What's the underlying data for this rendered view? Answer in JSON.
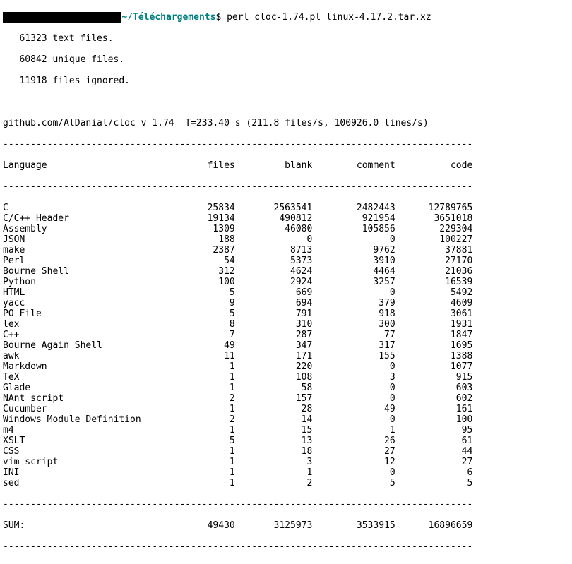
{
  "prompt": {
    "redacted": "xxxxxxxxxxxxxxxxxxxxx",
    "path": "~/Téléchargements",
    "dollar": "$",
    "command": "perl cloc-1.74.pl linux-4.17.2.tar.xz"
  },
  "preamble": {
    "line1": "   61323 text files.",
    "line2": "   60842 unique files.",
    "line3": "   11918 files ignored."
  },
  "meta_line": "github.com/AlDanial/cloc v 1.74  T=233.40 s (211.8 files/s, 100926.0 lines/s)",
  "header": {
    "language": "Language",
    "files": "files",
    "blank": "blank",
    "comment": "comment",
    "code": "code"
  },
  "rows": [
    {
      "language": "C",
      "files": "25834",
      "blank": "2563541",
      "comment": "2482443",
      "code": "12789765"
    },
    {
      "language": "C/C++ Header",
      "files": "19134",
      "blank": "490812",
      "comment": "921954",
      "code": "3651018"
    },
    {
      "language": "Assembly",
      "files": "1309",
      "blank": "46080",
      "comment": "105856",
      "code": "229304"
    },
    {
      "language": "JSON",
      "files": "188",
      "blank": "0",
      "comment": "0",
      "code": "100227"
    },
    {
      "language": "make",
      "files": "2387",
      "blank": "8713",
      "comment": "9762",
      "code": "37881"
    },
    {
      "language": "Perl",
      "files": "54",
      "blank": "5373",
      "comment": "3910",
      "code": "27170"
    },
    {
      "language": "Bourne Shell",
      "files": "312",
      "blank": "4624",
      "comment": "4464",
      "code": "21036"
    },
    {
      "language": "Python",
      "files": "100",
      "blank": "2924",
      "comment": "3257",
      "code": "16539"
    },
    {
      "language": "HTML",
      "files": "5",
      "blank": "669",
      "comment": "0",
      "code": "5492"
    },
    {
      "language": "yacc",
      "files": "9",
      "blank": "694",
      "comment": "379",
      "code": "4609"
    },
    {
      "language": "PO File",
      "files": "5",
      "blank": "791",
      "comment": "918",
      "code": "3061"
    },
    {
      "language": "lex",
      "files": "8",
      "blank": "310",
      "comment": "300",
      "code": "1931"
    },
    {
      "language": "C++",
      "files": "7",
      "blank": "287",
      "comment": "77",
      "code": "1847"
    },
    {
      "language": "Bourne Again Shell",
      "files": "49",
      "blank": "347",
      "comment": "317",
      "code": "1695"
    },
    {
      "language": "awk",
      "files": "11",
      "blank": "171",
      "comment": "155",
      "code": "1388"
    },
    {
      "language": "Markdown",
      "files": "1",
      "blank": "220",
      "comment": "0",
      "code": "1077"
    },
    {
      "language": "TeX",
      "files": "1",
      "blank": "108",
      "comment": "3",
      "code": "915"
    },
    {
      "language": "Glade",
      "files": "1",
      "blank": "58",
      "comment": "0",
      "code": "603"
    },
    {
      "language": "NAnt script",
      "files": "2",
      "blank": "157",
      "comment": "0",
      "code": "602"
    },
    {
      "language": "Cucumber",
      "files": "1",
      "blank": "28",
      "comment": "49",
      "code": "161"
    },
    {
      "language": "Windows Module Definition",
      "files": "2",
      "blank": "14",
      "comment": "0",
      "code": "100"
    },
    {
      "language": "m4",
      "files": "1",
      "blank": "15",
      "comment": "1",
      "code": "95"
    },
    {
      "language": "XSLT",
      "files": "5",
      "blank": "13",
      "comment": "26",
      "code": "61"
    },
    {
      "language": "CSS",
      "files": "1",
      "blank": "18",
      "comment": "27",
      "code": "44"
    },
    {
      "language": "vim script",
      "files": "1",
      "blank": "3",
      "comment": "12",
      "code": "27"
    },
    {
      "language": "INI",
      "files": "1",
      "blank": "1",
      "comment": "0",
      "code": "6"
    },
    {
      "language": "sed",
      "files": "1",
      "blank": "2",
      "comment": "5",
      "code": "5"
    }
  ],
  "sum": {
    "label": "SUM:",
    "files": "49430",
    "blank": "3125973",
    "comment": "3533915",
    "code": "16896659"
  },
  "divider": "-------------------------------------------------------------------------------------"
}
